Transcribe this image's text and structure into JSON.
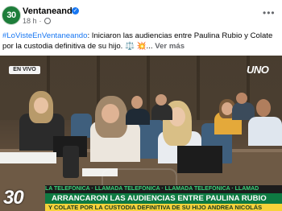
{
  "post": {
    "page_name": "Ventaneando",
    "time": "18 h",
    "avatar_text": "30",
    "more_label": "•••",
    "caption_hashtag": "#LoVisteEnVentaneando",
    "caption_text": ": Iniciaron las audiencias entre Paulina Rubio y Colate por la custodia definitiva de su hijo. ⚖️ 💥... ",
    "see_more": "Ver más"
  },
  "video": {
    "live_badge": "EN VIVO",
    "network_logo": "UNO",
    "ticker": "LA TELEFÓNICA · LLAMADA TELEFÓNICA · LLAMADA TELEFÓNICA · LLAMAD",
    "headline": "ARRANCARON LAS AUDIENCIAS ENTRE PAULINA RUBIO",
    "subline": "Y COLATE POR LA CUSTODIA DEFINITIVA DE SU HIJO ANDREA NICOLÁS",
    "channel_logo": "30"
  },
  "colors": {
    "verified": "#1877f2",
    "hashtag": "#1877f2",
    "headline_bg": "#0e7a42",
    "subline_bg": "#f7d23a"
  }
}
